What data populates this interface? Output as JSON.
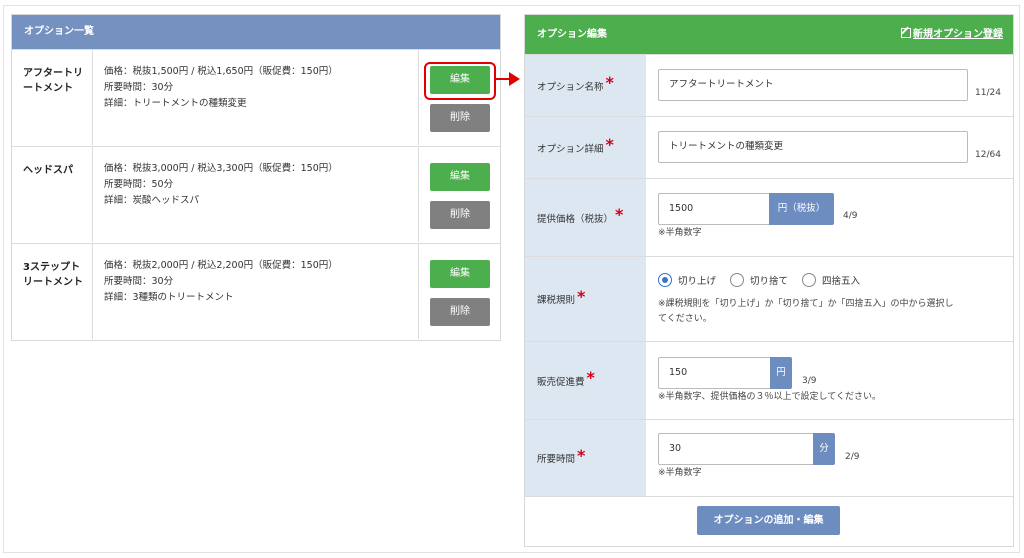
{
  "list": {
    "title": "オプション一覧",
    "items": [
      {
        "name": "アフタートリートメント",
        "price": "価格：税抜1,500円 / 税込1,650円（販促費：150円）",
        "time": "所要時間：30分",
        "detail": "詳細：トリートメントの種類変更",
        "edit_label": "編集",
        "delete_label": "削除"
      },
      {
        "name": "ヘッドスパ",
        "price": "価格：税抜3,000円 / 税込3,300円（販促費：150円）",
        "time": "所要時間：50分",
        "detail": "詳細：炭酸ヘッドスパ",
        "edit_label": "編集",
        "delete_label": "削除"
      },
      {
        "name": "3ステップトリートメント",
        "price": "価格：税抜2,000円 / 税込2,200円（販促費：150円）",
        "time": "所要時間：30分",
        "detail": "詳細：3種類のトリートメント",
        "edit_label": "編集",
        "delete_label": "削除"
      }
    ]
  },
  "form": {
    "title": "オプション編集",
    "new_link": "新規オプション登録",
    "required_mark": "*",
    "fields": {
      "name": {
        "label": "オプション名称",
        "value": "アフタートリートメント",
        "counter": "11/24"
      },
      "detail": {
        "label": "オプション詳細",
        "value": "トリートメントの種類変更",
        "counter": "12/64"
      },
      "price": {
        "label": "提供価格（税抜）",
        "value": "1500",
        "unit": "円（税抜）",
        "counter": "4/9",
        "note": "※半角数字"
      },
      "tax_rule": {
        "label": "課税規則",
        "options": [
          "切り上げ",
          "切り捨て",
          "四捨五入"
        ],
        "selected": "切り上げ",
        "note_line1": "※課税規則を「切り上げ」か「切り捨て」か「四捨五入」の中から選択し",
        "note_line2": "てください。"
      },
      "promo": {
        "label": "販売促進費",
        "value": "150",
        "unit": "円",
        "counter": "3/9",
        "note": "※半角数字、提供価格の３％以上で設定してください。"
      },
      "time": {
        "label": "所要時間",
        "value": "30",
        "unit": "分",
        "counter": "2/9",
        "note": "※半角数字"
      }
    },
    "submit_label": "オプションの追加・編集"
  },
  "colors": {
    "list_header": "#7591c0",
    "form_header": "#4cae4c",
    "edit_button": "#4cae4c",
    "delete_button": "#808080",
    "label_bg": "#dde7f2",
    "highlight": "#e00000"
  }
}
